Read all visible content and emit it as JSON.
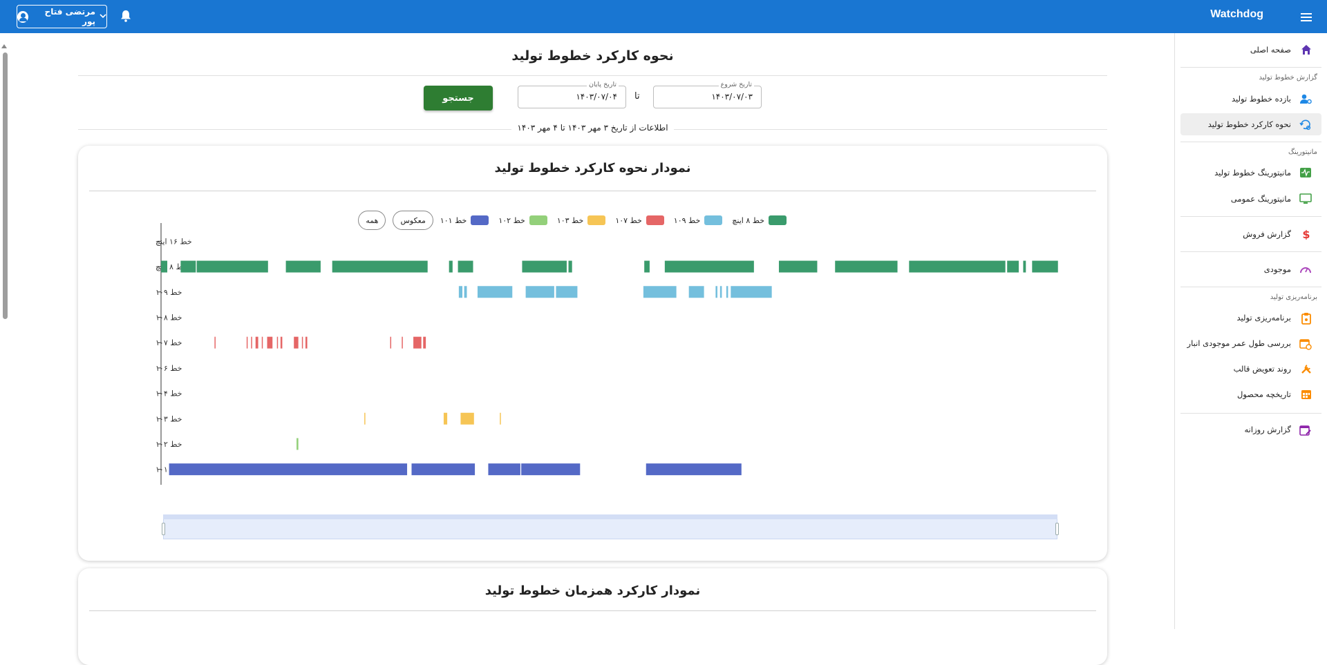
{
  "topbar": {
    "brand": "Watchdog",
    "user_name": "مرتضی فتاح پور"
  },
  "sidebar": {
    "home": "صفحه اصلی",
    "section_reports": "گزارش خطوط تولید",
    "item_efficiency": "بازده خطوط تولید",
    "item_operation": "نحوه کارکرد خطوط تولید",
    "section_monitoring": "مانیتورینگ",
    "item_mon_lines": "مانیتورینگ خطوط تولید",
    "item_mon_general": "مانیتورینگ عمومی",
    "item_sales": "گزارش فروش",
    "item_inventory": "موجودی",
    "section_planning": "برنامه‌ریزی تولید",
    "item_planning": "برنامه‌ریزی تولید",
    "item_shelf_life": "بررسی طول عمر موجودی انبار",
    "item_mold": "روند تعویض قالب",
    "item_history": "تاریخچه محصول",
    "item_daily": "گزارش روزانه"
  },
  "main": {
    "title": "نحوه کارکرد خطوط تولید",
    "start_label": "تاریخ شروع",
    "start_value": "۱۴۰۳/۰۷/۰۳",
    "to_label": "تا",
    "end_label": "تاریخ پایان",
    "end_value": "۱۴۰۳/۰۷/۰۴",
    "search_button": "جستجو",
    "info_text": "اطلاعات از تاریخ ۳ مهر ۱۴۰۳ تا ۴ مهر ۱۴۰۳",
    "card1_title": "نمودار نحوه کارکرد خطوط تولید",
    "card2_title": "نمودار کارکرد همزمان خطوط تولید",
    "btn_all": "همه",
    "btn_invert": "معکوس"
  },
  "chart_data": {
    "type": "timeline",
    "lines": [
      "خط ۱۶ اینچ",
      "خط ۸ اینچ",
      "خط ۱۰۹",
      "خط ۱۰۸",
      "خط ۱۰۷",
      "خط ۱۰۶",
      "خط ۱۰۴",
      "خط ۱۰۳",
      "خط ۱۰۲",
      "خط ۱۰۱"
    ],
    "legend": [
      {
        "name": "خط ۸ اینچ",
        "color": "#3a9b6c"
      },
      {
        "name": "خط ۱۰۹",
        "color": "#74bfdd"
      },
      {
        "name": "خط ۱۰۷",
        "color": "#e56666"
      },
      {
        "name": "خط ۱۰۳",
        "color": "#f6c555"
      },
      {
        "name": "خط ۱۰۲",
        "color": "#93d07a"
      },
      {
        "name": "خط ۱۰۱",
        "color": "#5469c6"
      }
    ],
    "x_range": [
      0,
      1000
    ],
    "segments": [
      {
        "line": 1,
        "color": "#3a9b6c",
        "ranges": [
          [
            0,
            7
          ],
          [
            22,
            39
          ],
          [
            40,
            120
          ],
          [
            140,
            179
          ],
          [
            192,
            299
          ],
          [
            323,
            327
          ],
          [
            333,
            350
          ],
          [
            405,
            455
          ],
          [
            457,
            461
          ],
          [
            542,
            548
          ],
          [
            565,
            665
          ],
          [
            693,
            736
          ],
          [
            756,
            826
          ],
          [
            839,
            947
          ],
          [
            949,
            962
          ],
          [
            967,
            970
          ],
          [
            977,
            1006
          ]
        ]
      },
      {
        "line": 2,
        "color": "#74bfdd",
        "ranges": [
          [
            334,
            338
          ],
          [
            340,
            343
          ],
          [
            355,
            394
          ],
          [
            409,
            441
          ],
          [
            443,
            467
          ],
          [
            541,
            578
          ],
          [
            592,
            609
          ],
          [
            622,
            624
          ],
          [
            627,
            629
          ],
          [
            634,
            636
          ],
          [
            639,
            685
          ]
        ]
      },
      {
        "line": 4,
        "color": "#e56666",
        "ranges": [
          [
            60,
            61
          ],
          [
            96,
            97
          ],
          [
            101,
            102
          ],
          [
            106,
            109
          ],
          [
            113,
            114
          ],
          [
            119,
            125
          ],
          [
            130,
            131
          ],
          [
            134,
            136
          ],
          [
            149,
            154
          ],
          [
            158,
            159
          ],
          [
            162,
            164
          ],
          [
            257,
            258
          ],
          [
            270,
            271
          ],
          [
            283,
            292
          ],
          [
            294,
            297
          ]
        ]
      },
      {
        "line": 7,
        "color": "#f6c555",
        "ranges": [
          [
            228,
            229
          ],
          [
            317,
            321
          ],
          [
            336,
            351
          ],
          [
            380,
            381
          ]
        ]
      },
      {
        "line": 8,
        "color": "#93d07a",
        "ranges": [
          [
            152,
            154
          ]
        ]
      },
      {
        "line": 9,
        "color": "#5469c6",
        "ranges": [
          [
            9,
            276
          ],
          [
            281,
            352
          ],
          [
            367,
            403
          ],
          [
            404,
            470
          ],
          [
            544,
            651
          ]
        ]
      }
    ]
  }
}
